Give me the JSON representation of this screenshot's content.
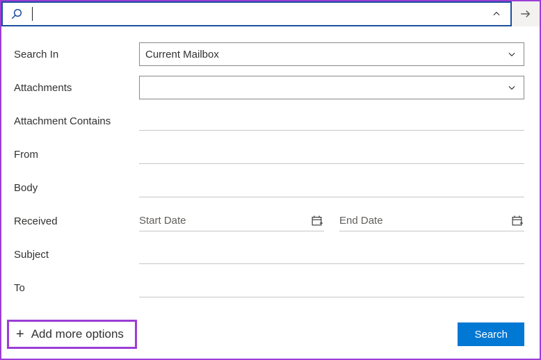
{
  "searchbar": {
    "value": "",
    "placeholder": ""
  },
  "form": {
    "search_in": {
      "label": "Search In",
      "value": "Current Mailbox"
    },
    "attachments": {
      "label": "Attachments",
      "value": ""
    },
    "attachment_contains": {
      "label": "Attachment Contains",
      "value": ""
    },
    "from": {
      "label": "From",
      "value": ""
    },
    "body": {
      "label": "Body",
      "value": ""
    },
    "received": {
      "label": "Received",
      "start_placeholder": "Start Date",
      "end_placeholder": "End Date"
    },
    "subject": {
      "label": "Subject",
      "value": ""
    },
    "to": {
      "label": "To",
      "value": ""
    }
  },
  "actions": {
    "add_more": "Add more options",
    "search": "Search"
  }
}
